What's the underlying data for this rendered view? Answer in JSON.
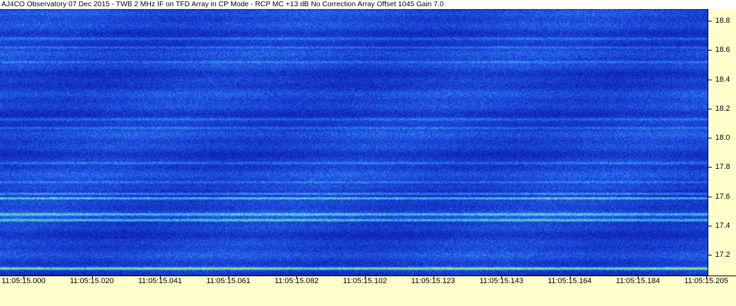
{
  "title": "AJ4CO Observatory 07 Dec 2015 - TWB 2 MHz IF on TFD Array in CP Mode - RCP  MC +13 dB  No Correction Array  Offset 1045  Gain 7.0",
  "chart_data": {
    "type": "heatmap",
    "title": "AJ4CO Observatory 07 Dec 2015 - TWB 2 MHz IF on TFD Array in CP Mode - RCP  MC +13 dB  No Correction Array  Offset 1045  Gain 7.0",
    "x_ticks": [
      "11:05:15.000",
      "11:05:15.020",
      "11:05:15.041",
      "11:05:15.061",
      "11:05:15.082",
      "11:05:15.102",
      "11:05:15.123",
      "11:05:15.143",
      "11:05:15.164",
      "11:05:15.184",
      "11:05:15.205"
    ],
    "y_ticks": [
      "18.8",
      "18.6",
      "18.4",
      "18.2",
      "18.0",
      "17.8",
      "17.6",
      "17.4",
      "17.2"
    ],
    "y_tick_values": [
      18.8,
      18.6,
      18.4,
      18.2,
      18.0,
      17.8,
      17.6,
      17.4,
      17.2
    ],
    "ylim": [
      17.06,
      18.88
    ],
    "colormap": [
      "#0a1fa8",
      "#1436c8",
      "#1e4fe0",
      "#2f78f0",
      "#3fb0f0",
      "#5fe0c0",
      "#b8f060",
      "#f0d040",
      "#f08030"
    ],
    "bands": [
      {
        "y": 17.11,
        "intensity": 0.95
      },
      {
        "y": 17.44,
        "intensity": 0.7
      },
      {
        "y": 17.48,
        "intensity": 0.55
      },
      {
        "y": 17.59,
        "intensity": 0.75
      },
      {
        "y": 17.62,
        "intensity": 0.6
      },
      {
        "y": 17.7,
        "intensity": 0.35
      },
      {
        "y": 17.83,
        "intensity": 0.3
      },
      {
        "y": 18.07,
        "intensity": 0.35
      },
      {
        "y": 18.13,
        "intensity": 0.3
      },
      {
        "y": 18.52,
        "intensity": 0.3
      },
      {
        "y": 18.62,
        "intensity": 0.35
      },
      {
        "y": 18.68,
        "intensity": 0.3
      }
    ]
  }
}
